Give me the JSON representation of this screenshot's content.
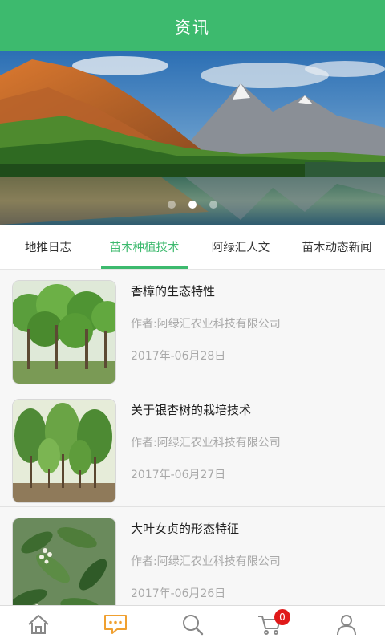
{
  "header": {
    "title": "资讯"
  },
  "banner": {
    "slide_count": 3,
    "active_slide": 2
  },
  "tabs": [
    {
      "label": "地推日志",
      "active": false
    },
    {
      "label": "苗木种植技术",
      "active": true
    },
    {
      "label": "阿绿汇人文",
      "active": false
    },
    {
      "label": "苗木动态新闻",
      "active": false
    }
  ],
  "articles": [
    {
      "title": "香樟的生态特性",
      "author": "作者:阿绿汇农业科技有限公司",
      "date": "2017年-06月28日",
      "image": "camphor-tree-photo"
    },
    {
      "title": "关于银杏树的栽培技术",
      "author": "作者:阿绿汇农业科技有限公司",
      "date": "2017年-06月27日",
      "image": "ginkgo-tree-photo"
    },
    {
      "title": "大叶女贞的形态特征",
      "author": "作者:阿绿汇农业科技有限公司",
      "date": "2017年-06月26日",
      "image": "privet-leaves-photo"
    }
  ],
  "bottom_nav": {
    "items": [
      {
        "icon": "home-icon",
        "active": false
      },
      {
        "icon": "message-icon",
        "active": true
      },
      {
        "icon": "search-icon",
        "active": false
      },
      {
        "icon": "cart-icon",
        "active": false
      },
      {
        "icon": "user-icon",
        "active": false
      }
    ],
    "cart_badge": "0"
  },
  "colors": {
    "brand_green": "#3dba6e",
    "active_nav": "#f0a030",
    "inactive_nav": "#888888",
    "badge_red": "#e01919"
  }
}
